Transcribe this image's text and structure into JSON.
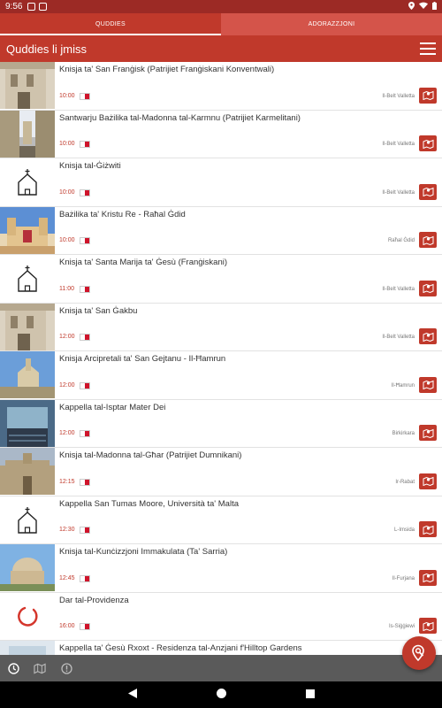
{
  "statusbar": {
    "time": "9:56"
  },
  "tabs": [
    {
      "label": "QUDDIES"
    },
    {
      "label": "ADORAZZJONI"
    }
  ],
  "header": {
    "title": "Quddies li jmiss"
  },
  "rows": [
    {
      "name": "Knisja ta' San Franġisk (Patrijiet Franġiskani Konventwali)",
      "time": "10:00",
      "location": "Il-Belt Valletta",
      "thumb": "building"
    },
    {
      "name": "Santwarju Bażilika tal-Madonna tal-Karmnu (Patrijiet Karmelitani)",
      "time": "10:00",
      "location": "Il-Belt Valletta",
      "thumb": "street"
    },
    {
      "name": "Knisja tal-Ġiżwiti",
      "time": "10:00",
      "location": "Il-Belt Valletta",
      "thumb": "church-icon"
    },
    {
      "name": "Bażilika ta' Kristu Re - Raħal Ġdid",
      "time": "10:00",
      "location": "Raħal Ġdid",
      "thumb": "basilica"
    },
    {
      "name": "Knisja ta' Santa Marija ta' Ġesù (Franġiskani)",
      "time": "11:00",
      "location": "Il-Belt Valletta",
      "thumb": "church-icon"
    },
    {
      "name": "Knisja ta' San Ġakbu",
      "time": "12:00",
      "location": "Il-Belt Valletta",
      "thumb": "building"
    },
    {
      "name": "Knisja Arcipretali ta' San Gejtanu - Il-Ħamrun",
      "time": "12:00",
      "location": "Il-Ħamrun",
      "thumb": "sky-church"
    },
    {
      "name": "Kappella tal-Isptar Mater Dei",
      "time": "12:00",
      "location": "Birkirkara",
      "thumb": "interior"
    },
    {
      "name": "Knisja tal-Madonna tal-Għar (Patrijiet Dumnikani)",
      "time": "12:15",
      "location": "Ir-Rabat",
      "thumb": "stone"
    },
    {
      "name": "Kappella San Tumas Moore, Università ta' Malta",
      "time": "12:30",
      "location": "L-Imsida",
      "thumb": "church-icon"
    },
    {
      "name": "Knisja tal-Kunċizzjoni Immakulata (Ta' Sarria)",
      "time": "12:45",
      "location": "Il-Furjana",
      "thumb": "dome"
    },
    {
      "name": "Dar tal-Providenza",
      "time": "16:00",
      "location": "Is-Siġġiewi",
      "thumb": "loading"
    },
    {
      "name": "Kappella ta' Ġesù Rxoxt - Residenza tal-Anzjani f'Hilltop Gardens",
      "time": "",
      "location": "",
      "thumb": "interior-light"
    }
  ],
  "colors": {
    "primary": "#c0392b",
    "primary_dark": "#9c2a25",
    "bottombar": "#5a5a5a"
  },
  "icons": {
    "bottombar": [
      "clock-icon",
      "map-icon",
      "info-icon"
    ],
    "fab": "search-location-icon",
    "row_button": "map-icon"
  }
}
